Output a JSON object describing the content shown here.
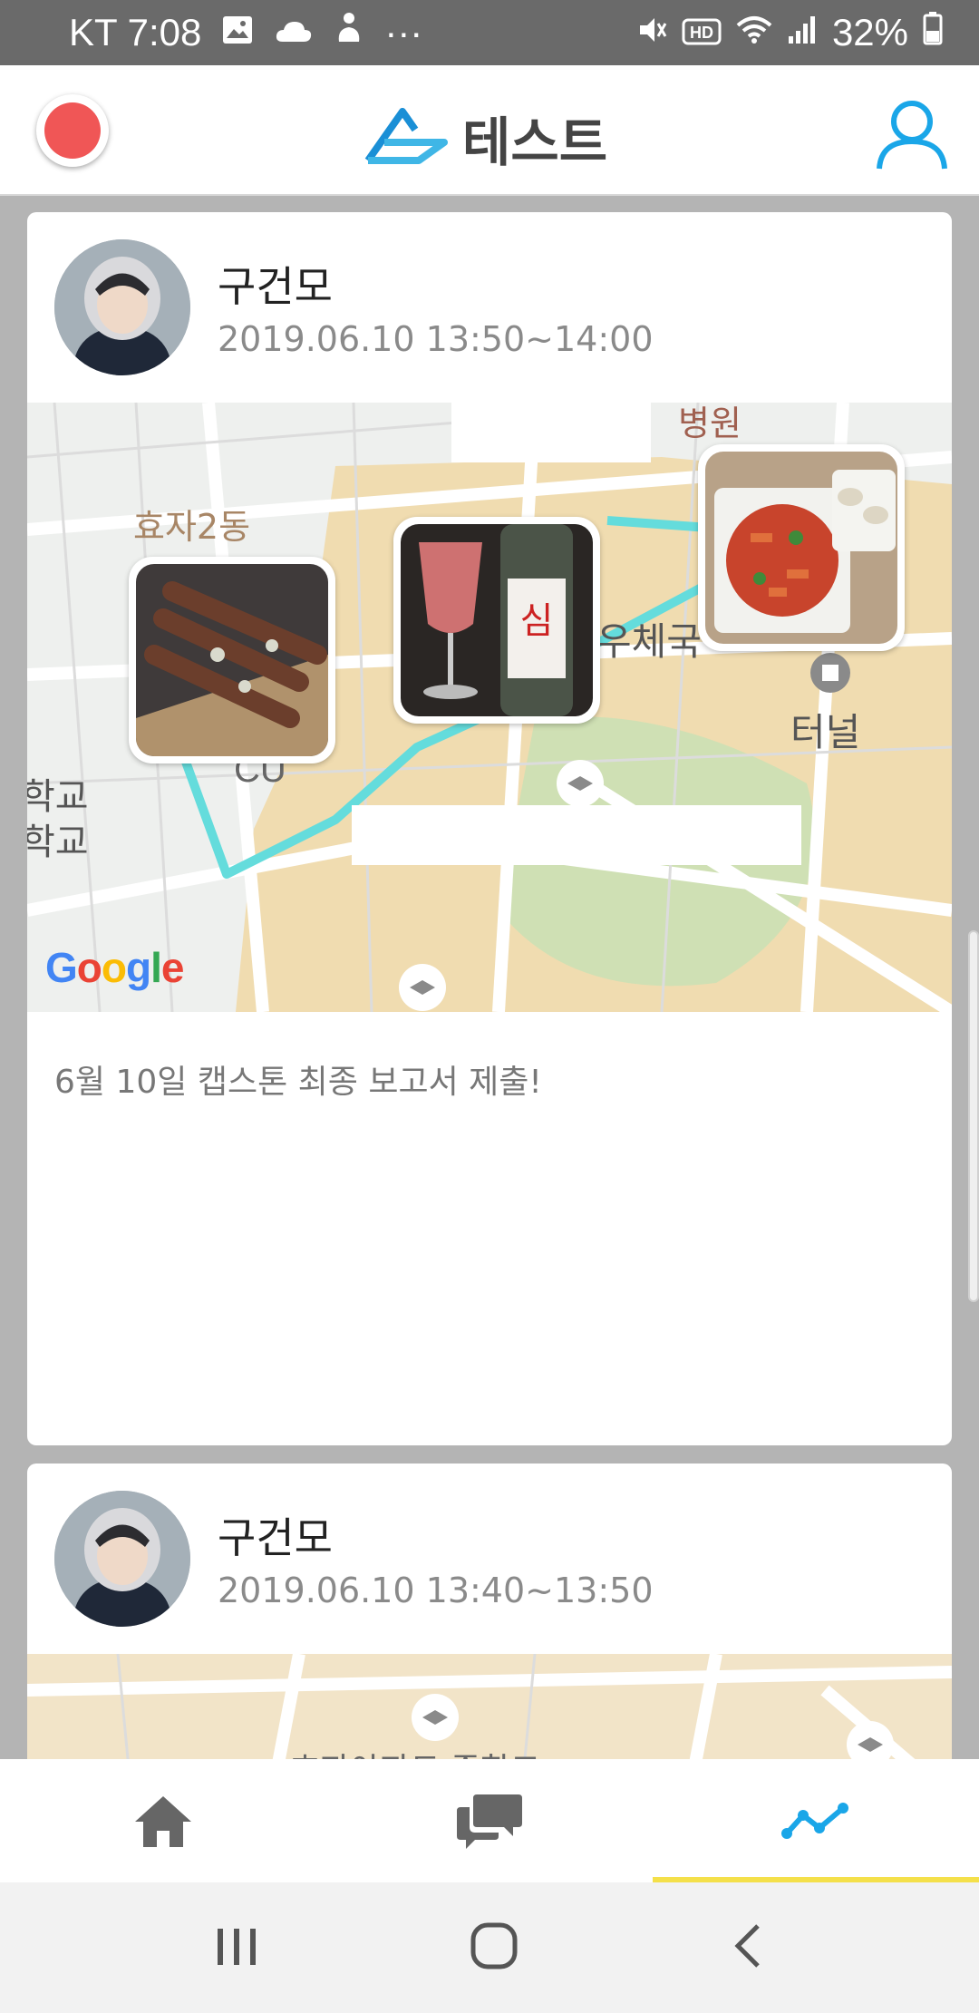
{
  "status_bar": {
    "carrier_time": "KT 7:08",
    "more": "···",
    "network": "HD",
    "battery": "32%"
  },
  "header": {
    "title": "테스트",
    "accent_color": "#1aa6e8",
    "record_color": "#f05656"
  },
  "feed": {
    "posts": [
      {
        "author": "구건모",
        "time": "2019.06.10 13:50~14:00",
        "text": "6월 10일 캡스톤 최종 보고서 제출!",
        "map": {
          "labels": [
            "효자2동",
            "병원",
            "우체국",
            "터널",
            "학교",
            "학교",
            "CU"
          ],
          "attribution": "Google",
          "photos": [
            "skewers-photo",
            "soju-drink-photo",
            "tteokbokki-photo"
          ]
        }
      },
      {
        "author": "구건모",
        "time": "2019.06.10 13:40~13:50",
        "text": "",
        "map": {
          "labels": [
            "효자아파트 중학교"
          ]
        }
      }
    ]
  },
  "bottom_nav": {
    "tabs": [
      {
        "icon": "home-icon",
        "active": false
      },
      {
        "icon": "chat-icon",
        "active": false
      },
      {
        "icon": "trend-icon",
        "active": true
      }
    ],
    "active_color": "#1aa6e8",
    "indicator_color": "#f4e04a"
  },
  "system_nav": {
    "buttons": [
      "recents-icon",
      "home-circle-icon",
      "back-icon"
    ]
  }
}
